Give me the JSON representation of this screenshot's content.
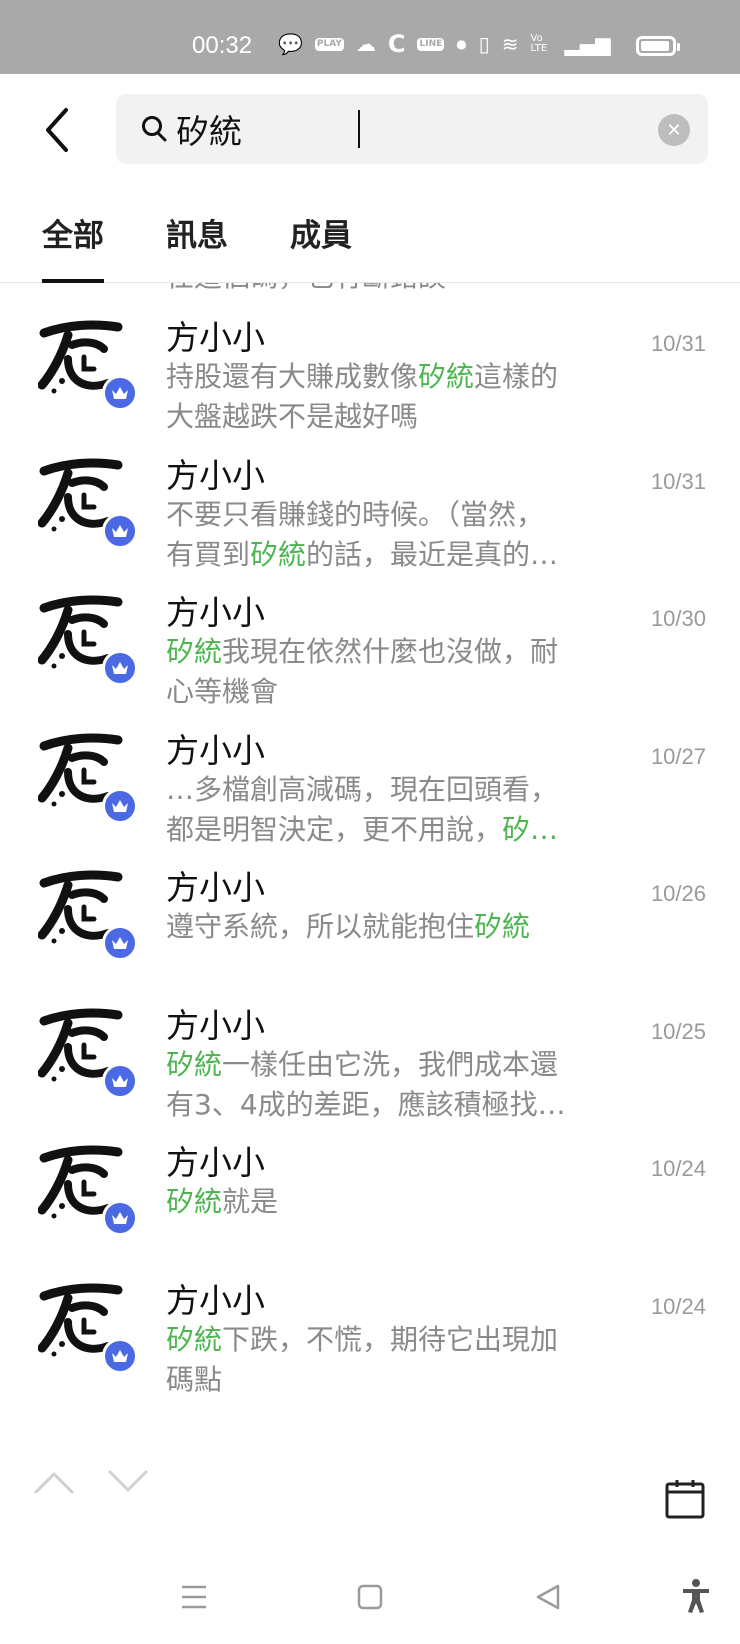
{
  "status_bar": {
    "time": "00:32",
    "badges": [
      "PLAY",
      "LINE"
    ],
    "volte": "Vo LTE"
  },
  "search": {
    "query": "矽統",
    "clear_icon": "✕"
  },
  "tabs": [
    {
      "label": "全部",
      "active": true
    },
    {
      "label": "訊息",
      "active": false
    },
    {
      "label": "成員",
      "active": false
    }
  ],
  "partial_row_text": "任這個碼，也有斷錯誤",
  "results": [
    {
      "name": "方小小",
      "date": "10/31",
      "line1": [
        "持股還有大賺成數像",
        {
          "hl": "矽統"
        },
        "這樣的"
      ],
      "line2": [
        "大盤越跌不是越好嗎"
      ]
    },
    {
      "name": "方小小",
      "date": "10/31",
      "line1": [
        "不要只看賺錢的時候。（當然，"
      ],
      "line2": [
        "有買到",
        {
          "hl": "矽統"
        },
        "的話，最近是真的…"
      ]
    },
    {
      "name": "方小小",
      "date": "10/30",
      "line1": [
        {
          "hl": "矽統"
        },
        "我現在依然什麼也沒做，耐"
      ],
      "line2": [
        "心等機會"
      ]
    },
    {
      "name": "方小小",
      "date": "10/27",
      "line1": [
        "…多檔創高減碼，現在回頭看，"
      ],
      "line2": [
        "都是明智決定，更不用說，",
        {
          "hl": "矽…"
        }
      ]
    },
    {
      "name": "方小小",
      "date": "10/26",
      "line1": [
        "遵守系統，所以就能抱住",
        {
          "hl": "矽統"
        }
      ],
      "line2": []
    },
    {
      "name": "方小小",
      "date": "10/25",
      "line1": [
        {
          "hl": "矽統"
        },
        "一樣任由它洗，我們成本還"
      ],
      "line2": [
        "有3、4成的差距，應該積極找…"
      ]
    },
    {
      "name": "方小小",
      "date": "10/24",
      "line1": [
        {
          "hl": "矽統"
        },
        "就是"
      ],
      "line2": []
    },
    {
      "name": "方小小",
      "date": "10/24",
      "line1": [
        {
          "hl": "矽統"
        },
        "下跌，不慌，期待它出現加"
      ],
      "line2": [
        "碼點"
      ]
    }
  ],
  "colors": {
    "highlight": "#4cb550",
    "crown_badge": "#4a69e2",
    "status_bar": "#a9a9a9"
  },
  "icons": {
    "back": "chevron-left-icon",
    "search": "magnifier-icon",
    "clear": "close-circle-icon",
    "prev": "chevron-up-icon",
    "next": "chevron-down-icon",
    "calendar": "calendar-icon",
    "crown": "crown-icon"
  }
}
